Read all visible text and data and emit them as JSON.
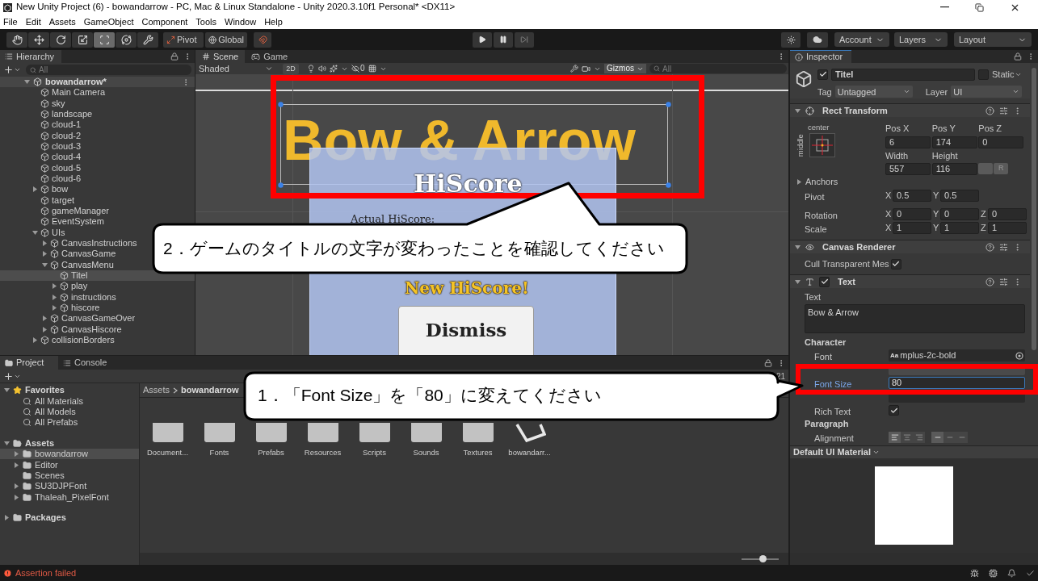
{
  "window": {
    "title": "New Unity Project (6) - bowandarrow - PC, Mac & Linux Standalone - Unity 2020.3.10f1 Personal* <DX11>"
  },
  "menu": [
    "File",
    "Edit",
    "Assets",
    "GameObject",
    "Component",
    "Tools",
    "Window",
    "Help"
  ],
  "toolbar": {
    "tools": [
      {
        "kind": "hand",
        "selected": false
      },
      {
        "kind": "move",
        "selected": false
      },
      {
        "kind": "rotate",
        "selected": false
      },
      {
        "kind": "scale",
        "selected": false
      },
      {
        "kind": "rect",
        "selected": true
      },
      {
        "kind": "transform",
        "selected": false
      },
      {
        "kind": "custom",
        "selected": false
      }
    ],
    "pivot": "Pivot",
    "global": "Global",
    "account": "Account",
    "layers": "Layers",
    "layout": "Layout"
  },
  "hierarchy": {
    "title": "Hierarchy",
    "search_placeholder": "All",
    "scene": "bowandarrow*",
    "items": [
      {
        "name": "Main Camera",
        "kind": "leaf",
        "selected": false
      },
      {
        "name": "sky",
        "kind": "leaf",
        "selected": false
      },
      {
        "name": "landscape",
        "kind": "leaf",
        "selected": false
      },
      {
        "name": "cloud-1",
        "kind": "leaf",
        "selected": false
      },
      {
        "name": "cloud-2",
        "kind": "leaf",
        "selected": false
      },
      {
        "name": "cloud-3",
        "kind": "leaf",
        "selected": false
      },
      {
        "name": "cloud-4",
        "kind": "leaf",
        "selected": false
      },
      {
        "name": "cloud-5",
        "kind": "leaf",
        "selected": false
      },
      {
        "name": "cloud-6",
        "kind": "leaf",
        "selected": false
      },
      {
        "name": "bow",
        "kind": "group",
        "expanded": false,
        "selected": false
      },
      {
        "name": "target",
        "kind": "leaf",
        "selected": false
      },
      {
        "name": "gameManager",
        "kind": "leaf",
        "selected": false
      },
      {
        "name": "EventSystem",
        "kind": "leaf",
        "selected": false
      },
      {
        "name": "UIs",
        "kind": "group",
        "expanded": true,
        "selected": false,
        "children": [
          {
            "name": "CanvasInstructions",
            "kind": "group",
            "expanded": false,
            "selected": false
          },
          {
            "name": "CanvasGame",
            "kind": "group",
            "expanded": false,
            "selected": false
          },
          {
            "name": "CanvasMenu",
            "kind": "group",
            "expanded": true,
            "selected": false,
            "children": [
              {
                "name": "Titel",
                "kind": "leaf",
                "selected": true
              },
              {
                "name": "play",
                "kind": "group",
                "expanded": false,
                "selected": false
              },
              {
                "name": "instructions",
                "kind": "group",
                "expanded": false,
                "selected": false
              },
              {
                "name": "hiscore",
                "kind": "group",
                "expanded": false,
                "selected": false
              }
            ]
          },
          {
            "name": "CanvasGameOver",
            "kind": "group",
            "expanded": false,
            "selected": false
          },
          {
            "name": "CanvasHiscore",
            "kind": "group",
            "expanded": false,
            "selected": false
          }
        ]
      },
      {
        "name": "collisionBorders",
        "kind": "group",
        "expanded": false,
        "selected": false
      }
    ]
  },
  "scene_view": {
    "tabs": [
      {
        "label": "Scene",
        "kind": "scene",
        "selected": true
      },
      {
        "label": "Game",
        "kind": "game",
        "selected": false
      }
    ],
    "shading": "Shaded",
    "mode_2d": "2D",
    "hidden_count": "0",
    "gizmos": "Gizmos",
    "search_placeholder": "All",
    "title_text": "Bow & Arrow",
    "panel": {
      "heading": "HiScore",
      "label": "Actual HiScore:",
      "new_score": "New HiScore!",
      "button": "Dismiss"
    }
  },
  "inspector": {
    "title": "Inspector",
    "object": {
      "name": "Titel",
      "active": true,
      "static_label": "Static",
      "static": false,
      "tag_label": "Tag",
      "tag": "Untagged",
      "layer_label": "Layer",
      "layer": "UI"
    },
    "rect_transform": {
      "title": "Rect Transform",
      "anchor_h": "center",
      "anchor_v": "middle",
      "fields": [
        {
          "label": "Pos X",
          "value": "6"
        },
        {
          "label": "Pos Y",
          "value": "174"
        },
        {
          "label": "Pos Z",
          "value": "0"
        },
        {
          "label": "Width",
          "value": "557"
        },
        {
          "label": "Height",
          "value": "116"
        }
      ],
      "r_button": "R",
      "anchors": "Anchors",
      "vectors": [
        {
          "label": "Pivot",
          "components": [
            {
              "axis": "X",
              "value": "0.5"
            },
            {
              "axis": "Y",
              "value": "0.5"
            }
          ]
        },
        {
          "label": "Rotation",
          "components": [
            {
              "axis": "X",
              "value": "0"
            },
            {
              "axis": "Y",
              "value": "0"
            },
            {
              "axis": "Z",
              "value": "0"
            }
          ]
        },
        {
          "label": "Scale",
          "components": [
            {
              "axis": "X",
              "value": "1"
            },
            {
              "axis": "Y",
              "value": "1"
            },
            {
              "axis": "Z",
              "value": "1"
            }
          ]
        }
      ]
    },
    "canvas_renderer": {
      "title": "Canvas Renderer",
      "cull_label": "Cull Transparent Mes",
      "cull": true
    },
    "text": {
      "title": "Text",
      "enabled": true,
      "text_label": "Text",
      "text_value": "Bow & Arrow",
      "character": "Character",
      "font_label": "Font",
      "font_prefix": "Aa",
      "font": "mplus-2c-bold",
      "font_size_label": "Font Size",
      "font_size": "80",
      "rich_text_label": "Rich Text",
      "rich_text": true,
      "paragraph": "Paragraph",
      "alignment_label": "Alignment",
      "h_align": [
        {
          "selected": true
        },
        {
          "selected": false
        },
        {
          "selected": false
        }
      ],
      "v_align": [
        {
          "selected": true
        },
        {
          "selected": false
        },
        {
          "selected": false
        }
      ]
    },
    "material": {
      "title": "Default UI Material"
    }
  },
  "project": {
    "tabs": [
      {
        "label": "Project",
        "kind": "project",
        "selected": true
      },
      {
        "label": "Console",
        "kind": "console",
        "selected": false
      }
    ],
    "count": "21",
    "tree": [
      {
        "name": "Favorites",
        "kind": "star",
        "expanded": true,
        "selected": false,
        "children": [
          {
            "name": "All Materials",
            "kind": "search",
            "selected": false
          },
          {
            "name": "All Models",
            "kind": "search",
            "selected": false
          },
          {
            "name": "All Prefabs",
            "kind": "search",
            "selected": false
          }
        ]
      },
      {
        "name": "Assets",
        "kind": "folder",
        "expanded": true,
        "selected": false,
        "children": [
          {
            "name": "bowandarrow",
            "kind": "folder",
            "expanded": false,
            "selected": true
          },
          {
            "name": "Editor",
            "kind": "folder",
            "expanded": false,
            "selected": false
          },
          {
            "name": "Scenes",
            "kind": "folder",
            "selected": false
          },
          {
            "name": "SU3DJPFont",
            "kind": "folder",
            "expanded": false,
            "selected": false
          },
          {
            "name": "Thaleah_PixelFont",
            "kind": "folder",
            "expanded": false,
            "selected": false
          }
        ]
      },
      {
        "name": "Packages",
        "kind": "folder",
        "expanded": false,
        "selected": false
      }
    ],
    "breadcrumb": [
      "Assets",
      "bowandarrow"
    ],
    "assets": [
      {
        "label": "Document...",
        "kind": "folder"
      },
      {
        "label": "Fonts",
        "kind": "folder"
      },
      {
        "label": "Prefabs",
        "kind": "folder"
      },
      {
        "label": "Resources",
        "kind": "folder"
      },
      {
        "label": "Scripts",
        "kind": "folder"
      },
      {
        "label": "Sounds",
        "kind": "folder"
      },
      {
        "label": "Textures",
        "kind": "folder"
      },
      {
        "label": "bowandarr...",
        "kind": "unity_scene"
      }
    ],
    "icon_size": {
      "level": 0.57
    }
  },
  "callouts": [
    {
      "text": "2．ゲームのタイトルの文字が変わったことを確認してください"
    },
    {
      "text": "1．「Font Size」を「80」に変えてください"
    }
  ],
  "status_bar": {
    "message": "Assertion failed"
  }
}
